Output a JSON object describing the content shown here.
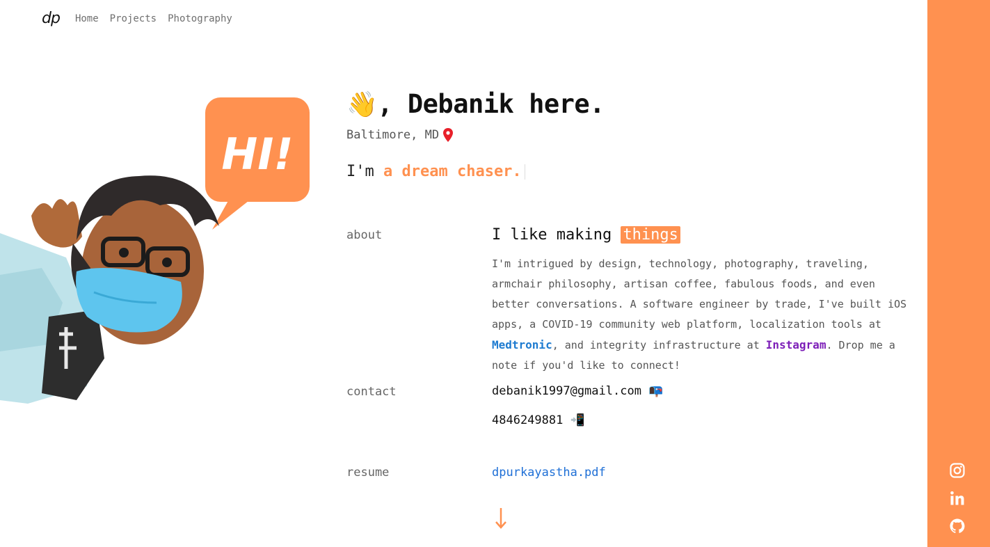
{
  "nav": {
    "logo": "dp",
    "items": [
      {
        "label": "Home"
      },
      {
        "label": "Projects"
      },
      {
        "label": "Photography"
      }
    ]
  },
  "hero": {
    "wave_emoji": "👋",
    "title": ", Debanik here.",
    "location": "Baltimore, MD",
    "tagline_prefix": "I'm",
    "tagline_accent": "a dream chaser.",
    "illustration_text": "HI!"
  },
  "about": {
    "label": "about",
    "heading_prefix": "I like making",
    "heading_highlight": "things",
    "body_part1": "I'm intrigued by design, technology, photography, traveling, armchair philosophy, artisan coffee, fabulous foods, and even better conversations. A software engineer by trade, I've built iOS apps, a COVID-19 community web platform, localization tools at",
    "link_medtronic": "Medtronic",
    "body_part2": ", and integrity infrastructure at",
    "link_instagram": "Instagram",
    "body_part3": ". Drop me a note if you'd like to connect!"
  },
  "contact": {
    "label": "contact",
    "email": "debanik1997@gmail.com",
    "email_emoji": "📭",
    "phone": "4846249881",
    "phone_emoji": "📲"
  },
  "resume": {
    "label": "resume",
    "file": "dpurkayastha.pdf"
  },
  "social": [
    "instagram-icon",
    "linkedin-icon",
    "github-icon"
  ],
  "colors": {
    "accent": "#ff9150",
    "link_blue": "#1e6fd6",
    "link_purple": "#7d1fb8",
    "pin_red": "#e8202a"
  }
}
